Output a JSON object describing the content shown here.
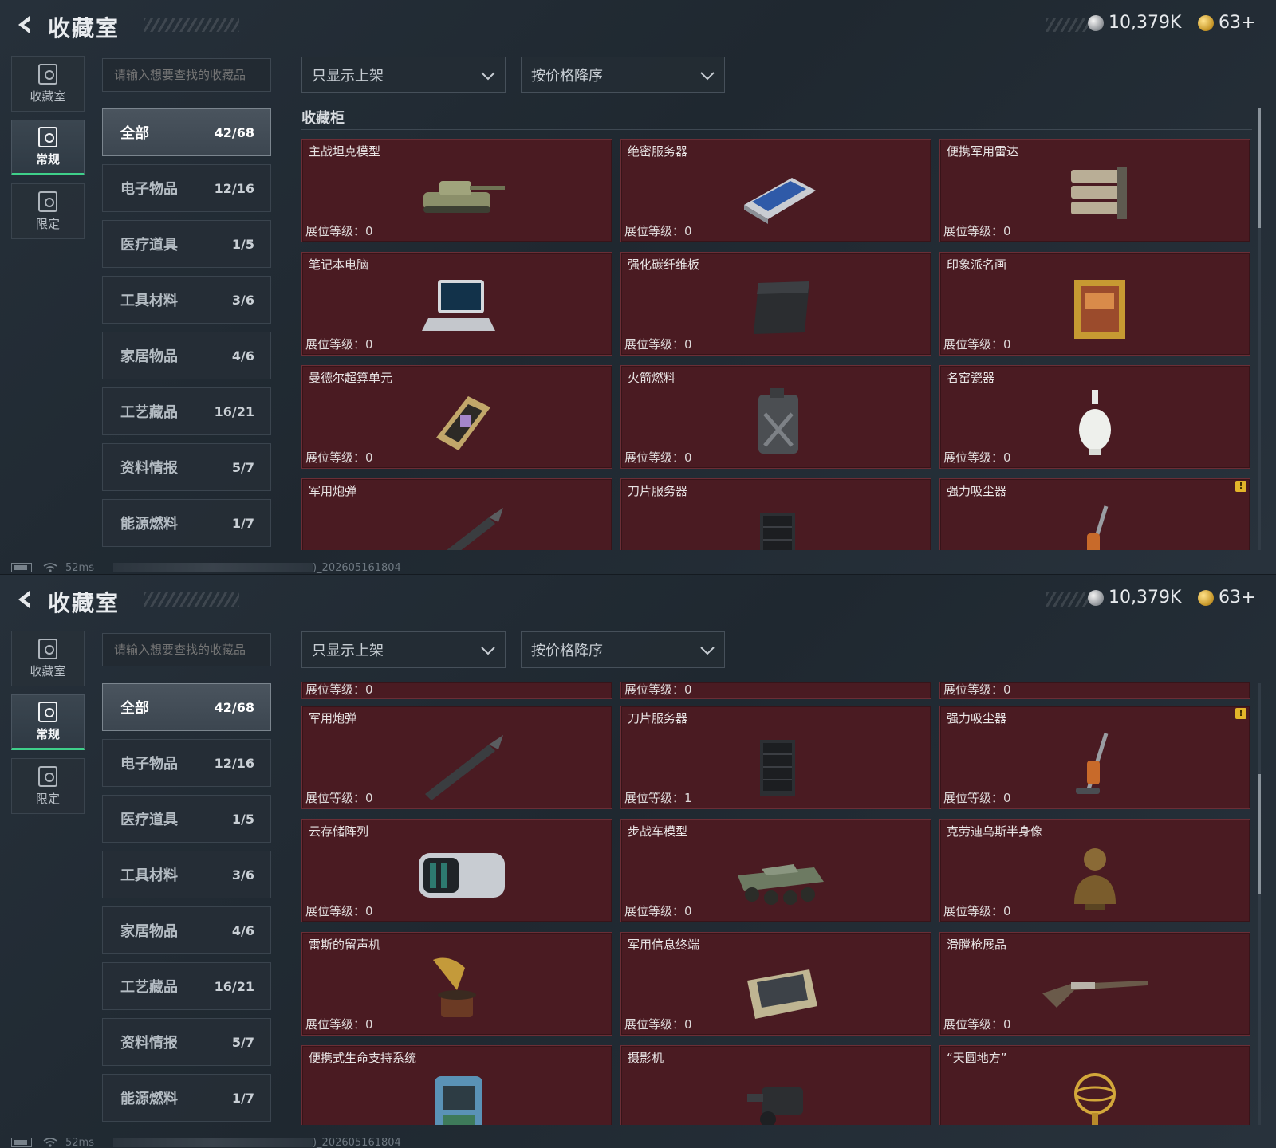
{
  "header": {
    "title": "收藏室",
    "silver": "10,379K",
    "gold": "63+"
  },
  "rail": [
    {
      "label": "收藏室",
      "icon": "collection-room-icon"
    },
    {
      "label": "常规",
      "icon": "regular-icon",
      "active": true
    },
    {
      "label": "限定",
      "icon": "limited-icon"
    }
  ],
  "search": {
    "placeholder": "请输入想要查找的收藏品"
  },
  "filters": {
    "show": "只显示上架",
    "sort": "按价格降序"
  },
  "categories": [
    {
      "label": "全部",
      "count": "42/68",
      "active": true
    },
    {
      "label": "电子物品",
      "count": "12/16"
    },
    {
      "label": "医疗道具",
      "count": "1/5"
    },
    {
      "label": "工具材料",
      "count": "3/6"
    },
    {
      "label": "家居物品",
      "count": "4/6"
    },
    {
      "label": "工艺藏品",
      "count": "16/21"
    },
    {
      "label": "资料情报",
      "count": "5/7"
    },
    {
      "label": "能源燃料",
      "count": "1/7"
    }
  ],
  "section": {
    "title": "收藏柜"
  },
  "level_label": "展位等级：",
  "panel1_items": [
    {
      "name": "主战坦克模型",
      "level": "0",
      "icon": "tank-icon"
    },
    {
      "name": "绝密服务器",
      "level": "0",
      "icon": "server-icon"
    },
    {
      "name": "便携军用雷达",
      "level": "0",
      "icon": "radar-icon"
    },
    {
      "name": "笔记本电脑",
      "level": "0",
      "icon": "laptop-icon"
    },
    {
      "name": "强化碳纤维板",
      "level": "0",
      "icon": "carbon-plate-icon"
    },
    {
      "name": "印象派名画",
      "level": "0",
      "icon": "painting-icon"
    },
    {
      "name": "曼德尔超算单元",
      "level": "0",
      "icon": "supercomputer-icon"
    },
    {
      "name": "火箭燃料",
      "level": "0",
      "icon": "fuel-can-icon"
    },
    {
      "name": "名窑瓷器",
      "level": "0",
      "icon": "vase-icon"
    },
    {
      "name": "军用炮弹",
      "level": "",
      "icon": "shell-icon"
    },
    {
      "name": "刀片服务器",
      "level": "",
      "icon": "blade-server-icon"
    },
    {
      "name": "强力吸尘器",
      "level": "",
      "icon": "vacuum-icon",
      "warn": "!"
    }
  ],
  "panel2_partial": [
    {
      "level": "0"
    },
    {
      "level": "0"
    },
    {
      "level": "0"
    }
  ],
  "panel2_items": [
    {
      "name": "军用炮弹",
      "level": "0",
      "icon": "shell-icon"
    },
    {
      "name": "刀片服务器",
      "level": "1",
      "icon": "blade-server-icon"
    },
    {
      "name": "强力吸尘器",
      "level": "0",
      "icon": "vacuum-icon",
      "warn": "!"
    },
    {
      "name": "云存储阵列",
      "level": "0",
      "icon": "storage-array-icon"
    },
    {
      "name": "步战车模型",
      "level": "0",
      "icon": "ifv-icon"
    },
    {
      "name": "克劳迪乌斯半身像",
      "level": "0",
      "icon": "bust-icon"
    },
    {
      "name": "雷斯的留声机",
      "level": "0",
      "icon": "gramophone-icon"
    },
    {
      "name": "军用信息终端",
      "level": "0",
      "icon": "terminal-icon"
    },
    {
      "name": "滑膛枪展品",
      "level": "0",
      "icon": "musket-icon"
    },
    {
      "name": "便携式生命支持系统",
      "level": "",
      "icon": "life-support-icon"
    },
    {
      "name": "摄影机",
      "level": "",
      "icon": "camera-icon"
    },
    {
      "name": "“天圆地方”",
      "level": "",
      "icon": "armillary-icon"
    }
  ],
  "status": {
    "ping": "52ms",
    "build": ")_202605161804"
  }
}
